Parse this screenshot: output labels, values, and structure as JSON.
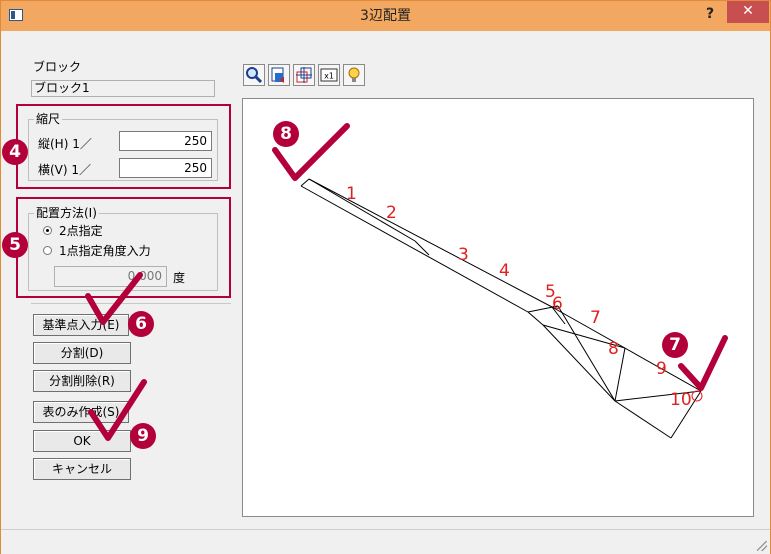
{
  "window": {
    "title": "3辺配置",
    "help": "?",
    "close": "✕"
  },
  "block": {
    "label": "ブロック",
    "value": "ブロック1"
  },
  "scale": {
    "legend": "縮尺",
    "vertical_label": "縦(H)  1／",
    "vertical_value": "250",
    "horizontal_label": "横(V)  1／",
    "horizontal_value": "250"
  },
  "placement": {
    "legend": "配置方法(I)",
    "option1": "2点指定",
    "option2": "1点指定角度入力",
    "selected": "2点指定",
    "angle_value": "0.000",
    "angle_unit": "度"
  },
  "buttons": {
    "base_point": "基準点入力(E)",
    "split": "分割(D)",
    "split_delete": "分割削除(R)",
    "table_only": "表のみ作成(S)",
    "ok": "OK",
    "cancel": "キャンセル"
  },
  "toolbar": [
    "zoom-icon",
    "zoom-extents-icon",
    "center-icon",
    "scale-x1-icon",
    "lightbulb-icon"
  ],
  "badges": {
    "b4": "4",
    "b5": "5",
    "b6": "6",
    "b7": "7",
    "b8": "8",
    "b9": "9"
  },
  "canvas_labels": [
    "1",
    "2",
    "3",
    "4",
    "5",
    "6",
    "7",
    "8",
    "9",
    "10"
  ],
  "colors": {
    "accent": "#b3003b",
    "titlebar": "#f2a860",
    "close": "#c74f4f",
    "label_red": "#e02020"
  }
}
